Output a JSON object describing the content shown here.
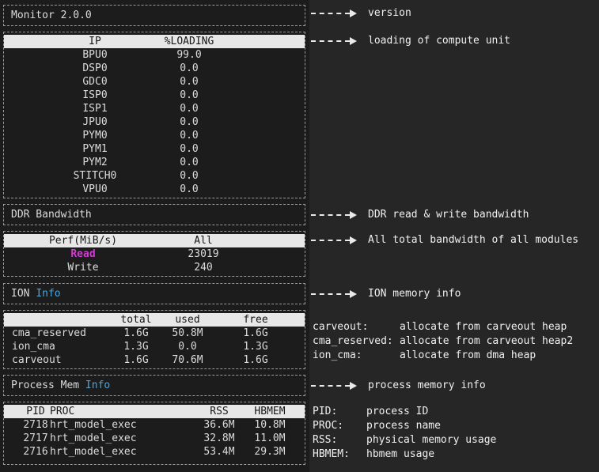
{
  "terminal": {
    "title": "Monitor 2.0.0",
    "ip_table": {
      "headers": [
        "IP",
        "%LOADING"
      ],
      "rows": [
        [
          "BPU0",
          "99.0"
        ],
        [
          "DSP0",
          "0.0"
        ],
        [
          "GDC0",
          "0.0"
        ],
        [
          "ISP0",
          "0.0"
        ],
        [
          "ISP1",
          "0.0"
        ],
        [
          "JPU0",
          "0.0"
        ],
        [
          "PYM0",
          "0.0"
        ],
        [
          "PYM1",
          "0.0"
        ],
        [
          "PYM2",
          "0.0"
        ],
        [
          "STITCH0",
          "0.0"
        ],
        [
          "VPU0",
          "0.0"
        ]
      ]
    },
    "ddr_title": "DDR Bandwidth",
    "perf_table": {
      "headers": [
        "Perf(MiB/s)",
        "All"
      ],
      "rows": [
        [
          "Read",
          "23019"
        ],
        [
          "Write",
          "240"
        ]
      ]
    },
    "ion_title": {
      "prefix": "ION",
      "highlight": "Info"
    },
    "ion_table": {
      "headers": [
        "total",
        "used",
        "free"
      ],
      "rows": [
        [
          "cma_reserved",
          "1.6G",
          "50.8M",
          "1.6G"
        ],
        [
          "ion_cma",
          "1.3G",
          "0.0",
          "1.3G"
        ],
        [
          "carveout",
          "1.6G",
          "70.6M",
          "1.6G"
        ]
      ]
    },
    "proc_title": {
      "prefix": "Process Mem",
      "highlight": "Info"
    },
    "proc_table": {
      "headers": [
        "PID",
        "PROC",
        "RSS",
        "HBMEM"
      ],
      "rows": [
        [
          "2718",
          "hrt_model_exec",
          "36.6M",
          "10.8M"
        ],
        [
          "2717",
          "hrt_model_exec",
          "32.8M",
          "11.0M"
        ],
        [
          "2716",
          "hrt_model_exec",
          "53.4M",
          "29.3M"
        ]
      ]
    }
  },
  "annotations": {
    "version": "version",
    "loading": "loading of compute unit",
    "ddr": "DDR read & write bandwidth",
    "all_bandwidth": "All total bandwidth of all modules",
    "ion": "ION memory info",
    "process": "process memory info",
    "ion_notes": [
      {
        "term": "carveout:",
        "desc": "allocate from carveout heap"
      },
      {
        "term": "cma_reserved:",
        "desc": "allocate from carveout heap2"
      },
      {
        "term": "ion_cma:",
        "desc": "allocate from dma heap"
      }
    ],
    "proc_notes": [
      {
        "term": "PID:",
        "desc": "process ID"
      },
      {
        "term": "PROC:",
        "desc": "process name"
      },
      {
        "term": "RSS:",
        "desc": "physical memory usage"
      },
      {
        "term": "HBMEM:",
        "desc": "hbmem usage"
      }
    ]
  },
  "colors": {
    "accent_magenta": "#d23bd2",
    "accent_blue": "#46a7e0",
    "header_bg": "#e7e7e7"
  }
}
